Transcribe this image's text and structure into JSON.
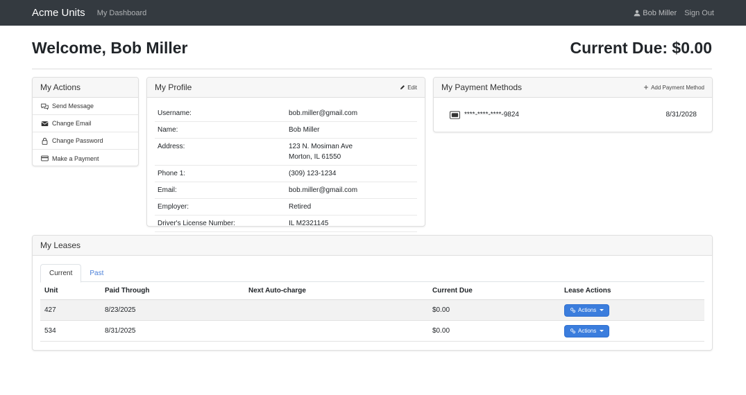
{
  "nav": {
    "brand": "Acme Units",
    "dashboard_link": "My Dashboard",
    "user_name": "Bob Miller",
    "sign_out": "Sign Out"
  },
  "header": {
    "welcome": "Welcome, Bob Miller",
    "current_due": "Current Due: $0.00"
  },
  "my_actions": {
    "title": "My Actions",
    "items": [
      {
        "label": "Send Message",
        "icon": "chat-bubbles-icon"
      },
      {
        "label": "Change Email",
        "icon": "envelope-icon"
      },
      {
        "label": "Change Password",
        "icon": "lock-icon"
      },
      {
        "label": "Make a Payment",
        "icon": "credit-card-icon"
      }
    ]
  },
  "profile": {
    "title": "My Profile",
    "edit_label": "Edit",
    "rows": [
      {
        "label": "Username:",
        "value": "bob.miller@gmail.com"
      },
      {
        "label": "Name:",
        "value": "Bob Miller"
      },
      {
        "label": "Address:",
        "value": "123 N. Mosiman Ave",
        "value2": "Morton, IL 61550"
      },
      {
        "label": "Phone 1:",
        "value": "(309) 123-1234"
      },
      {
        "label": "Email:",
        "value": "bob.miller@gmail.com"
      },
      {
        "label": "Employer:",
        "value": "Retired"
      },
      {
        "label": "Driver's License Number:",
        "value": "IL M2321145"
      }
    ]
  },
  "payment_methods": {
    "title": "My Payment Methods",
    "add_label": "Add Payment Method",
    "methods": [
      {
        "number": "****-****-****-9824",
        "expiry": "8/31/2028"
      }
    ]
  },
  "leases": {
    "title": "My Leases",
    "tabs": [
      "Current",
      "Past"
    ],
    "columns": [
      "Unit",
      "Paid Through",
      "Next Auto-charge",
      "Current Due",
      "Lease Actions"
    ],
    "rows": [
      {
        "unit": "427",
        "paid_through": "8/23/2025",
        "next_auto_charge": "",
        "current_due": "$0.00",
        "action": "Actions"
      },
      {
        "unit": "534",
        "paid_through": "8/31/2025",
        "next_auto_charge": "",
        "current_due": "$0.00",
        "action": "Actions"
      }
    ]
  },
  "colors": {
    "navbar": "#343a40",
    "link": "#4a7fd8",
    "button": "#3b7ddd"
  }
}
